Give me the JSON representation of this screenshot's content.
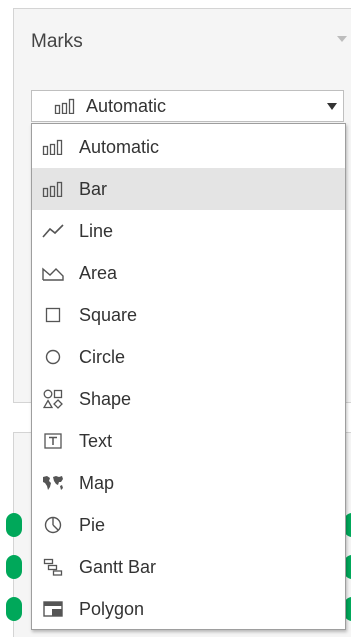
{
  "marks_card": {
    "title": "Marks",
    "selected_value": "Automatic",
    "selected_icon": "bar-chart-icon"
  },
  "mark_types": [
    {
      "label": "Automatic",
      "icon": "bar-chart-icon"
    },
    {
      "label": "Bar",
      "icon": "bar-chart-icon",
      "hovered": true
    },
    {
      "label": "Line",
      "icon": "line-chart-icon"
    },
    {
      "label": "Area",
      "icon": "area-chart-icon"
    },
    {
      "label": "Square",
      "icon": "square-icon"
    },
    {
      "label": "Circle",
      "icon": "circle-icon"
    },
    {
      "label": "Shape",
      "icon": "shapes-icon"
    },
    {
      "label": "Text",
      "icon": "text-icon"
    },
    {
      "label": "Map",
      "icon": "map-icon"
    },
    {
      "label": "Pie",
      "icon": "pie-icon"
    },
    {
      "label": "Gantt Bar",
      "icon": "gantt-icon"
    },
    {
      "label": "Polygon",
      "icon": "polygon-icon"
    }
  ],
  "colors": {
    "panel_bg": "#f5f5f5",
    "hover_bg": "#e4e4e4",
    "pill_green": "#00a85a",
    "text": "#333333"
  }
}
